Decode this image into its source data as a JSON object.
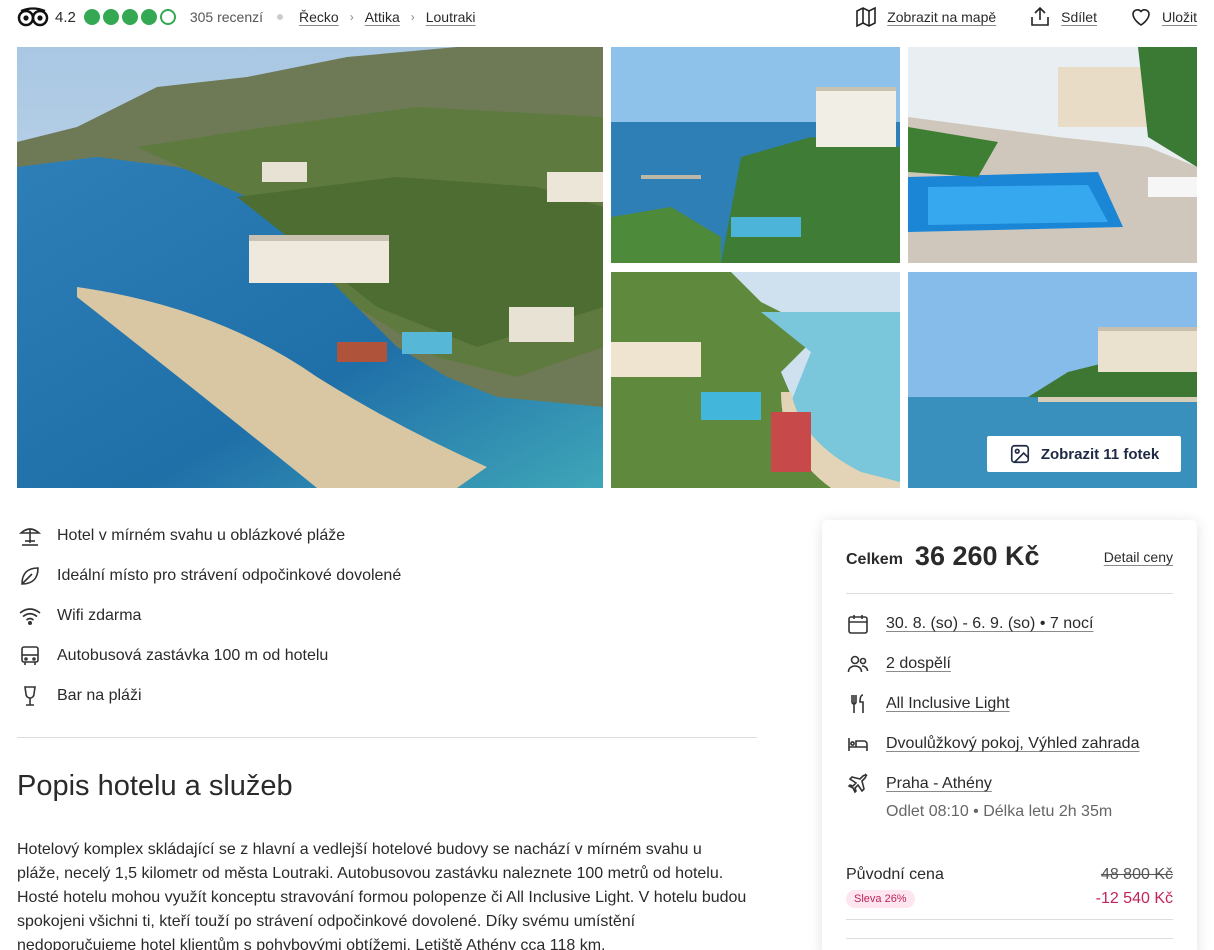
{
  "topbar": {
    "rating": "4.2",
    "bubbles_filled": 4,
    "bubbles_total": 5,
    "reviews": "305 recenzí",
    "breadcrumbs": [
      "Řecko",
      "Attika",
      "Loutraki"
    ],
    "actions": {
      "map": "Zobrazit na mapě",
      "share": "Sdílet",
      "save": "Uložit"
    }
  },
  "gallery": {
    "show_photos": "Zobrazit 11 fotek"
  },
  "features": [
    {
      "icon": "beach-umbrella-icon",
      "label": "Hotel v mírném svahu u oblázkové pláže"
    },
    {
      "icon": "leaf-icon",
      "label": "Ideální místo pro strávení odpočinkové dovolené"
    },
    {
      "icon": "wifi-icon",
      "label": "Wifi zdarma"
    },
    {
      "icon": "bus-icon",
      "label": "Autobusová zastávka 100 m od hotelu"
    },
    {
      "icon": "wine-glass-icon",
      "label": "Bar na pláži"
    }
  ],
  "description": {
    "title": "Popis hotelu a služeb",
    "text": "Hotelový komplex skládající se z hlavní a vedlejší hotelové budovy se nachází v mírném svahu u pláže, necelý 1,5 kilometr od města Loutraki. Autobusovou zastávku naleznete 100 metrů od hotelu. Hosté hotelu mohou využít konceptu stravování formou polopenze či All Inclusive Light. V hotelu budou spokojeni všichni ti, kteří touží po strávení odpočinkové dovolené. Díky svému umístění nedoporučujeme hotel klientům s pohybovými obtížemi. Letiště Athény cca 118 km."
  },
  "price_card": {
    "total_label": "Celkem",
    "total_value": "36 260 Kč",
    "detail_link": "Detail ceny",
    "dates": "30. 8. (so) - 6. 9. (so) • 7 nocí",
    "travelers": "2 dospělí",
    "board": "All Inclusive Light",
    "room": "Dvoulůžkový pokoj, Výhled zahrada",
    "flight": "Praha - Athény",
    "flight_details": "Odlet 08:10 • Délka letu 2h 35m",
    "original_label": "Původní cena",
    "original_value": "48 800 Kč",
    "discount_badge": "Sleva 26%",
    "discount_value": "-12 540 Kč"
  },
  "colors": {
    "accent_green": "#34a853",
    "discount_red": "#c0245c",
    "text": "#2a2a2a"
  }
}
